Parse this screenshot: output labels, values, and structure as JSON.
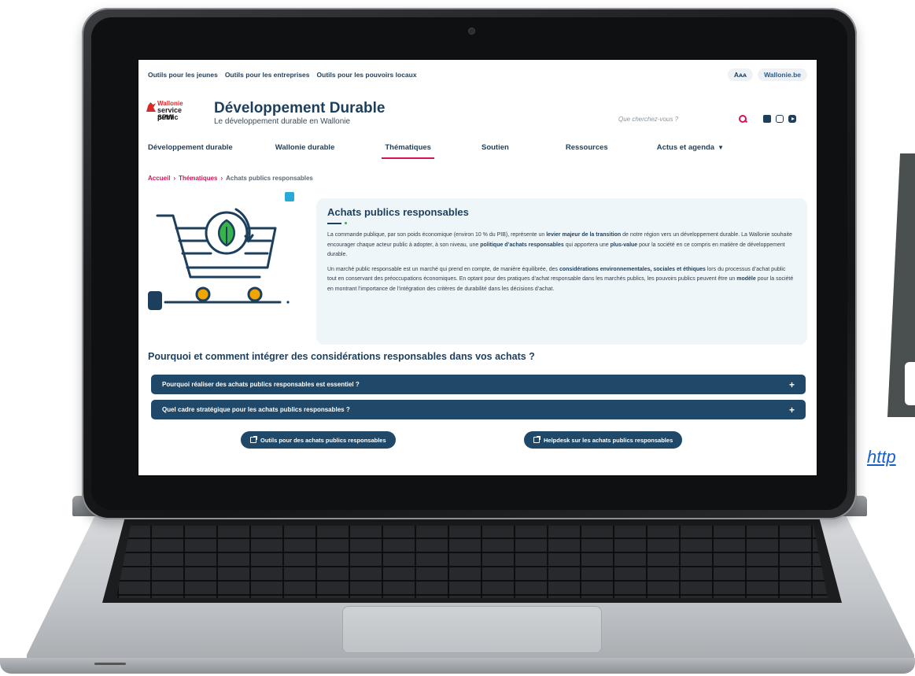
{
  "background": {
    "partial_link": "http",
    "colors": {
      "slab": "#4a4f4f",
      "link": "#1a5fc8"
    }
  },
  "site": {
    "utility_links": [
      "Outils pour les jeunes",
      "Outils pour les entreprises",
      "Outils pour les pouvoirs locaux"
    ],
    "font_size_button": "Aᴀᴀ",
    "wallonie_button": "Wallonie.be",
    "logo": {
      "line1": "Wallonie",
      "line2": "service public",
      "line3": "SPW"
    },
    "title": "Développement Durable",
    "subtitle": "Le développement durable en Wallonie",
    "search": {
      "placeholder": "Que cherchez-vous ?"
    },
    "social_icons": [
      "facebook-icon",
      "instagram-icon",
      "youtube-icon"
    ],
    "nav": [
      {
        "label": "Développement durable",
        "active": false
      },
      {
        "label": "Wallonie durable",
        "active": false
      },
      {
        "label": "Thématiques",
        "active": true
      },
      {
        "label": "Soutien",
        "active": false
      },
      {
        "label": "Ressources",
        "active": false
      },
      {
        "label": "Actus et agenda",
        "active": false,
        "dropdown": true
      }
    ],
    "breadcrumb": {
      "home": "Accueil",
      "section": "Thématiques",
      "current": "Achats publics responsables",
      "separator": "›"
    },
    "intro": {
      "heading": "Achats publics responsables",
      "p1": {
        "a": "La commande publique, par son poids économique (environ 10 % du PIB), représente un ",
        "b": "levier majeur de la transition",
        "c": " de notre région vers un développement durable. La Wallonie souhaite encourager chaque acteur public à adopter, à son niveau, une ",
        "d": "politique d’achats responsables",
        "e": " qui apportera une ",
        "f": "plus-value",
        "g": " pour la société en ce compris en matière de développement durable."
      },
      "p2": {
        "a": "Un marché public responsable est un marché qui prend en compte, de manière équilibrée, des ",
        "b": "considérations environnementales, sociales et éthiques",
        "c": " lors du processus d’achat public tout en conservant des préoccupations économiques. En optant pour des pratiques d’achat responsable dans les marchés publics, les pouvoirs publics peuvent être un ",
        "d": "modèle",
        "e": " pour la société en montrant l’importance de l’intégration des critères de durabilité dans les décisions d’achat."
      }
    },
    "section_title": "Pourquoi et comment intégrer des considérations responsables dans vos achats ?",
    "accordions": [
      "Pourquoi réaliser des achats publics responsables est essentiel ?",
      "Quel cadre stratégique pour les achats publics responsables ?"
    ],
    "expand_symbol": "+",
    "cta_buttons": [
      "Outils pour des achats publics responsables",
      "Helpdesk sur les achats publics responsables"
    ],
    "colors": {
      "primary": "#1c3f5e",
      "accent": "#d4145a",
      "panel": "#eef6fa",
      "bar": "#1f4869",
      "leaf": "#38b24a",
      "orange": "#f0a500",
      "cyan": "#29a9d6"
    }
  }
}
